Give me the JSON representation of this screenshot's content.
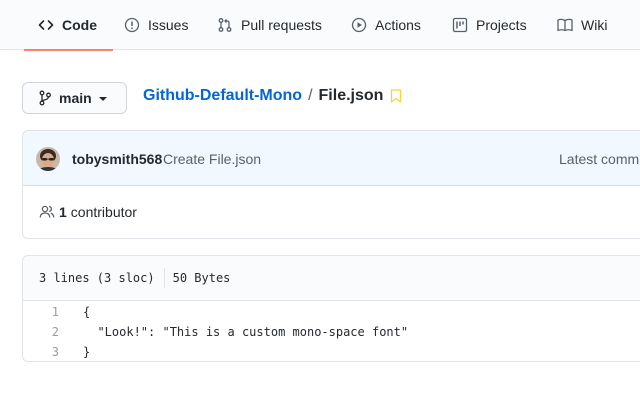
{
  "nav": {
    "tabs": [
      {
        "label": "Code",
        "icon": "code-icon",
        "active": true
      },
      {
        "label": "Issues",
        "icon": "issue-icon",
        "active": false
      },
      {
        "label": "Pull requests",
        "icon": "pull-request-icon",
        "active": false
      },
      {
        "label": "Actions",
        "icon": "play-icon",
        "active": false
      },
      {
        "label": "Projects",
        "icon": "project-icon",
        "active": false
      },
      {
        "label": "Wiki",
        "icon": "book-icon",
        "active": false
      }
    ]
  },
  "branch": {
    "label": "main"
  },
  "breadcrumb": {
    "repo": "Github-Default-Mono",
    "separator": "/",
    "file": "File.json"
  },
  "commit": {
    "author": "tobysmith568",
    "message": "Create File.json",
    "latest": "Latest commit"
  },
  "contributors": {
    "count": "1",
    "label": "contributor"
  },
  "file": {
    "lines_info": "3 lines (3 sloc)",
    "size": "50 Bytes",
    "lines": [
      {
        "num": "1",
        "text": "{"
      },
      {
        "num": "2",
        "text": "  \"Look!\": \"This is a custom mono-space font\""
      },
      {
        "num": "3",
        "text": "}"
      }
    ]
  },
  "colors": {
    "accent": "#f9826c",
    "link": "#0366d6",
    "commit_bg": "#f1f8ff"
  }
}
